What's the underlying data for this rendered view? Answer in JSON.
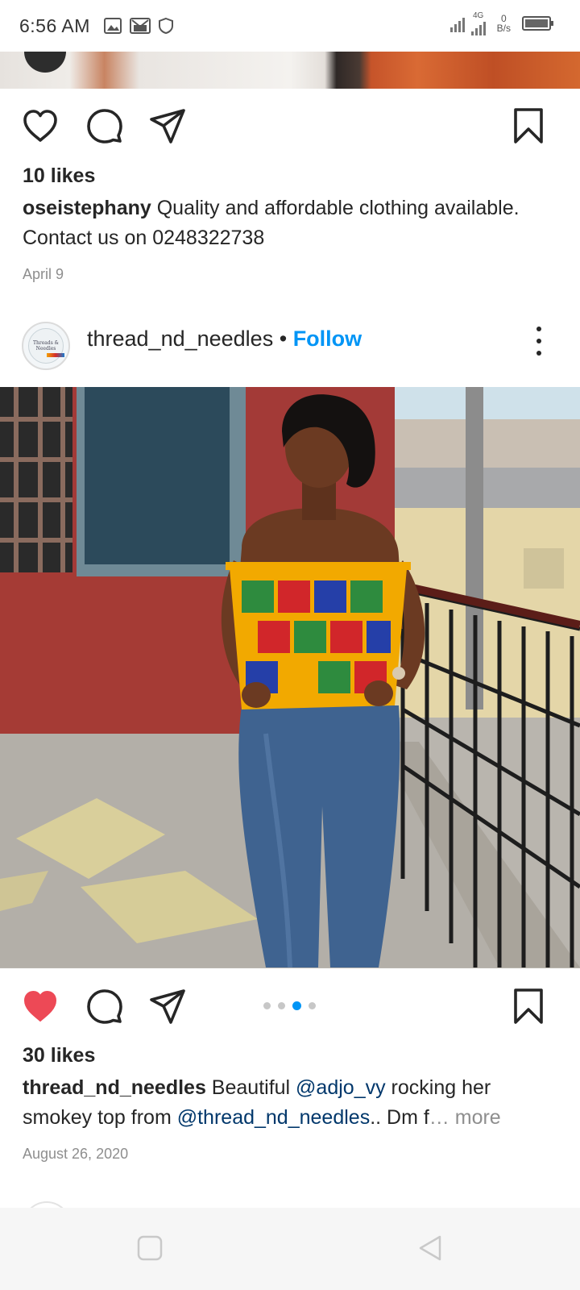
{
  "status_bar": {
    "time": "6:56 AM",
    "network_type": "4G",
    "data_speed_value": "0",
    "data_speed_unit": "B/s"
  },
  "previous_post": {
    "likes": "10 likes",
    "username": "oseistephany",
    "caption": " Quality and affordable clothing available. Contact us on 0248322738",
    "date": "April 9"
  },
  "post": {
    "avatar_text": "Threads & Needles",
    "username": "thread_nd_needles",
    "separator": "•",
    "follow_label": "Follow",
    "carousel": {
      "total": 4,
      "active_index": 2
    },
    "liked": true,
    "likes": "30 likes",
    "caption_user": "thread_nd_needles",
    "caption_part1": " Beautiful ",
    "mention1": "@adjo_vy",
    "caption_part2": " rocking her smokey top from ",
    "mention2": "@thread_nd_needles",
    "caption_part3": ".. Dm f",
    "ellipsis": "…",
    "more_label": "more",
    "date": "August 26, 2020"
  },
  "colors": {
    "accent": "#0095f6",
    "like_red": "#ed4956",
    "mention": "#00376b",
    "muted": "#8e8e8e"
  },
  "icons": {
    "heart_outline": "heart-icon",
    "heart_filled": "heart-filled-icon",
    "comment": "comment-icon",
    "share": "send-icon",
    "save": "bookmark-icon",
    "more": "more-vertical-icon"
  }
}
